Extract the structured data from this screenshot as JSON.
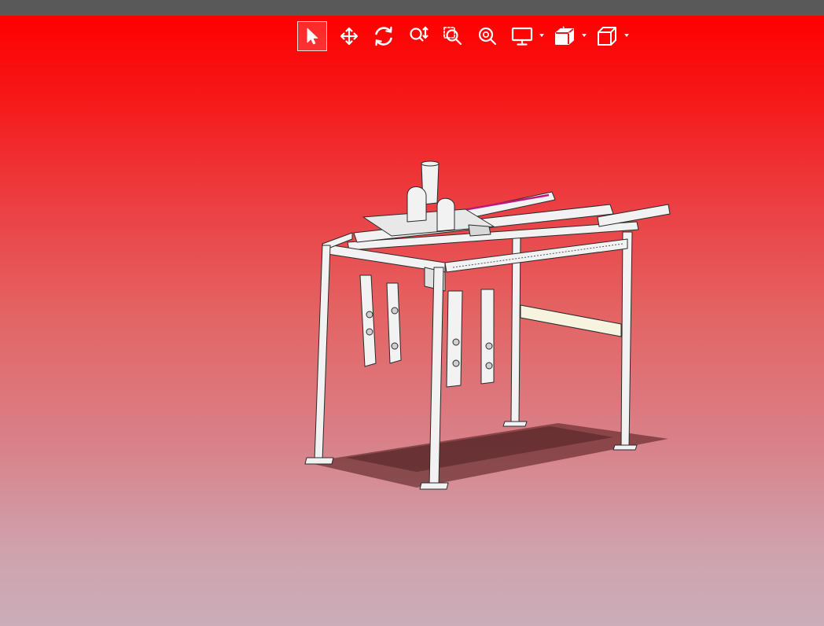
{
  "viewer": {
    "toolbar": [
      {
        "id": "select",
        "icon": "select-arrow-icon",
        "active": true
      },
      {
        "id": "pan",
        "icon": "pan-move-icon"
      },
      {
        "id": "rotate",
        "icon": "rotate-icon"
      },
      {
        "id": "zoom",
        "icon": "zoom-in-out-icon"
      },
      {
        "id": "zoom-window",
        "icon": "zoom-window-icon"
      },
      {
        "id": "zoom-fit",
        "icon": "zoom-fit-icon"
      },
      {
        "id": "display-mode",
        "icon": "monitor-icon",
        "dropdown": true
      },
      {
        "id": "section-view",
        "icon": "section-cube-icon",
        "dropdown": true
      },
      {
        "id": "view-orientation",
        "icon": "view-cube-icon",
        "dropdown": true
      }
    ],
    "model": {
      "subject": "gantry-frame-assembly"
    },
    "colors": {
      "background_top": "#ff0000",
      "background_bottom": "#caadb8",
      "topbar": "#595959",
      "icon": "#ffffff"
    }
  }
}
